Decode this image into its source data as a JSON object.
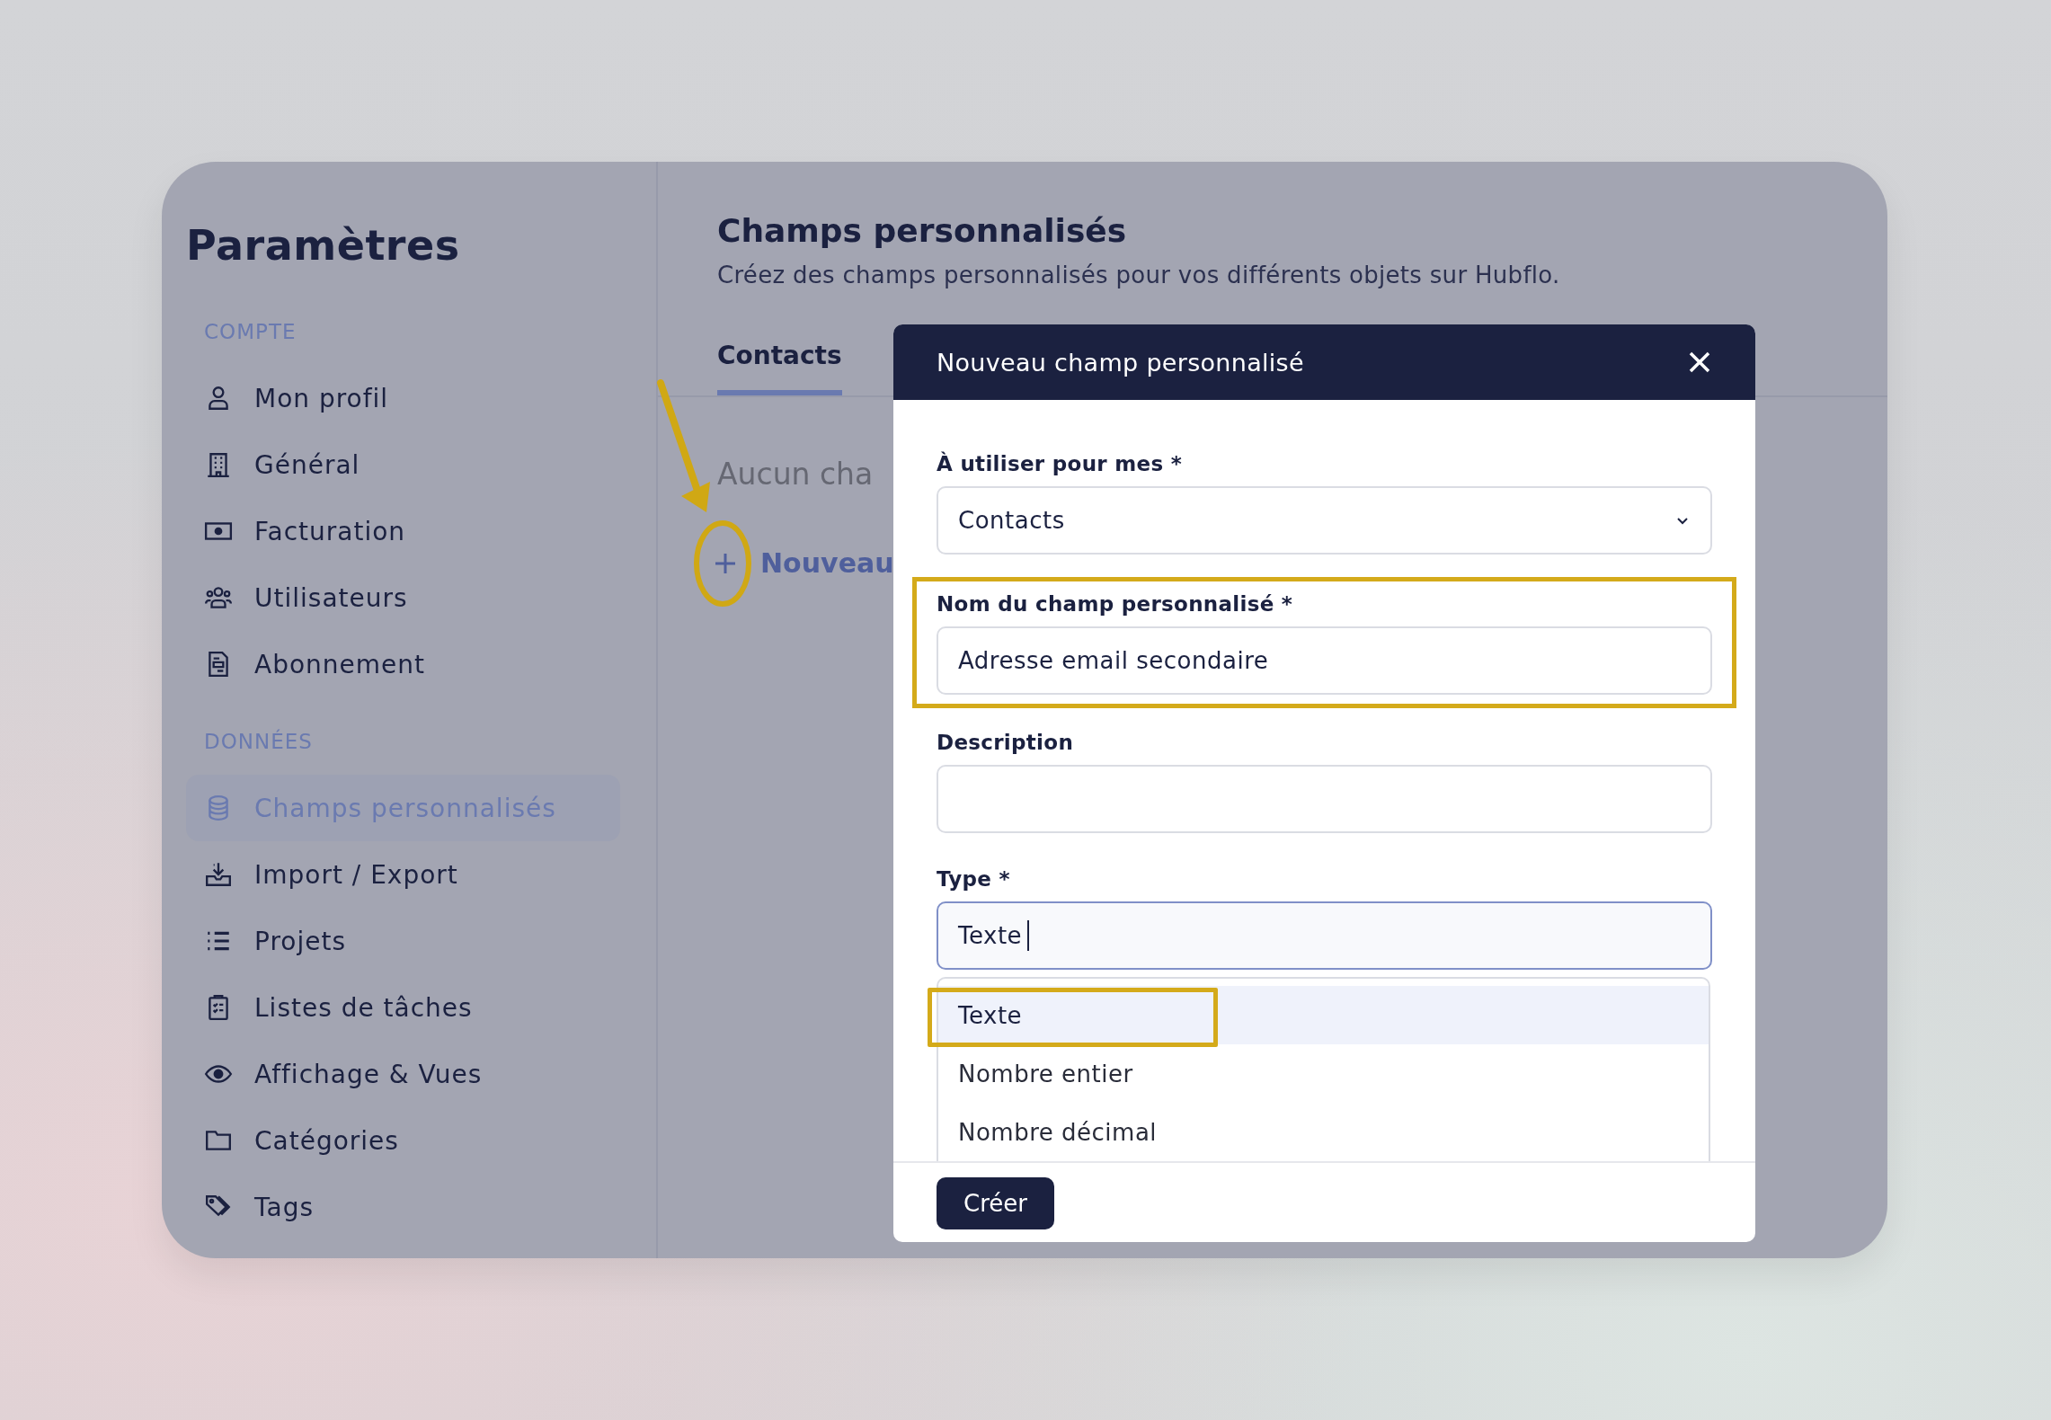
{
  "sidebar": {
    "title": "Paramètres",
    "sections": [
      {
        "heading": "COMPTE",
        "items": [
          {
            "label": "Mon profil",
            "selected": false
          },
          {
            "label": "Général",
            "selected": false
          },
          {
            "label": "Facturation",
            "selected": false
          },
          {
            "label": "Utilisateurs",
            "selected": false
          },
          {
            "label": "Abonnement",
            "selected": false
          }
        ]
      },
      {
        "heading": "DONNÉES",
        "items": [
          {
            "label": "Champs personnalisés",
            "selected": true
          },
          {
            "label": "Import / Export",
            "selected": false
          },
          {
            "label": "Projets",
            "selected": false
          },
          {
            "label": "Listes de tâches",
            "selected": false
          },
          {
            "label": "Affichage & Vues",
            "selected": false
          },
          {
            "label": "Catégories",
            "selected": false
          },
          {
            "label": "Tags",
            "selected": false
          }
        ]
      }
    ]
  },
  "main": {
    "title": "Champs personnalisés",
    "subtitle": "Créez des champs personnalisés pour vos différents objets sur Hubflo.",
    "tabs": [
      {
        "label": "Contacts",
        "selected": true
      }
    ],
    "empty_text": "Aucun cha",
    "new_button": {
      "label": "Nouveau",
      "annotated": true
    }
  },
  "modal": {
    "title": "Nouveau champ personnalisé",
    "fields": [
      {
        "kind": "select",
        "label": "À utiliser pour mes *",
        "value": "Contacts",
        "highlighted": false
      },
      {
        "kind": "text",
        "label": "Nom du champ personnalisé *",
        "value": "Adresse email secondaire",
        "highlighted": true
      },
      {
        "kind": "text",
        "label": "Description",
        "highlighted": false
      },
      {
        "kind": "combobox",
        "label": "Type *",
        "value": "Texte",
        "highlighted": false,
        "options": [
          {
            "label": "Texte",
            "selected": true,
            "highlighted": true
          },
          {
            "label": "Nombre entier",
            "selected": false,
            "highlighted": false
          },
          {
            "label": "Nombre décimal",
            "selected": false,
            "highlighted": false
          }
        ]
      }
    ],
    "submit": "Créer"
  }
}
